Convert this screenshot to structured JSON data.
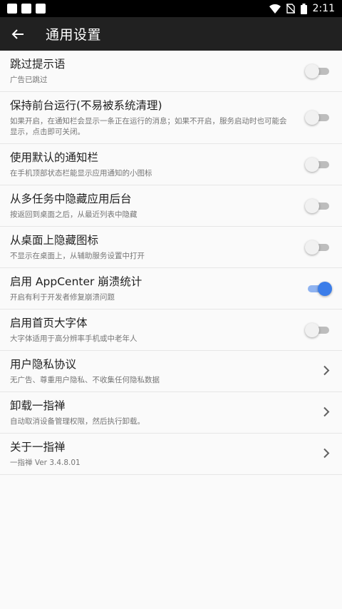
{
  "statusbar": {
    "time": "2:11"
  },
  "appbar": {
    "title": "通用设置"
  },
  "accent_color": "#3b7de9",
  "items": [
    {
      "title": "跳过提示语",
      "subtitle": "广告已跳过",
      "control": "switch",
      "on": false
    },
    {
      "title": "保持前台运行(不易被系统清理)",
      "subtitle": "如果开启，在通知栏会显示一条正在运行的消息；如果不开启，服务启动时也可能会显示，点击即可关闭。",
      "control": "switch",
      "on": false
    },
    {
      "title": "使用默认的通知栏",
      "subtitle": "在手机顶部状态栏能显示应用通知的小图标",
      "control": "switch",
      "on": false
    },
    {
      "title": "从多任务中隐藏应用后台",
      "subtitle": "按返回到桌面之后，从最近列表中隐藏",
      "control": "switch",
      "on": false
    },
    {
      "title": "从桌面上隐藏图标",
      "subtitle": "不显示在桌面上，从辅助服务设置中打开",
      "control": "switch",
      "on": false
    },
    {
      "title": "启用 AppCenter 崩溃统计",
      "subtitle": "开启有利于开发者修复崩溃问题",
      "control": "switch",
      "on": true
    },
    {
      "title": "启用首页大字体",
      "subtitle": "大字体适用于高分辨率手机或中老年人",
      "control": "switch",
      "on": false
    },
    {
      "title": "用户隐私协议",
      "subtitle": "无广告、尊重用户隐私、不收集任何隐私数据",
      "control": "chevron"
    },
    {
      "title": "卸载一指禅",
      "subtitle": "自动取消设备管理权限，然后执行卸载。",
      "control": "chevron"
    },
    {
      "title": "关于一指禅",
      "subtitle": "一指禅 Ver 3.4.8.01",
      "control": "chevron"
    }
  ]
}
